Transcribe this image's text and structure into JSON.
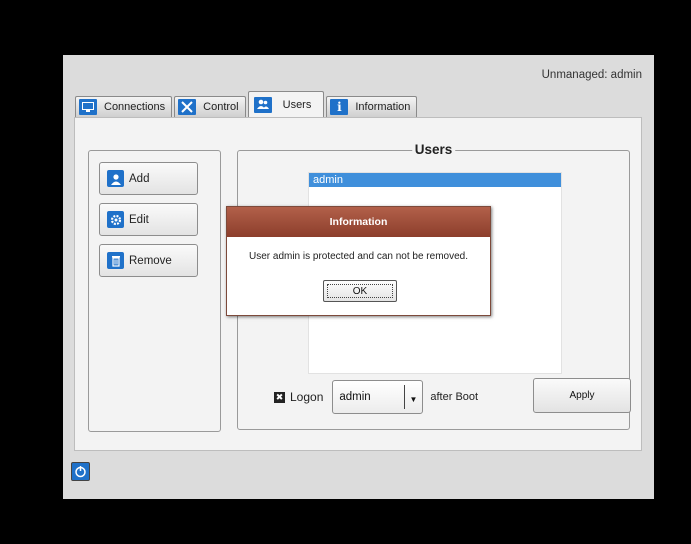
{
  "status": {
    "text": "Unmanaged: admin"
  },
  "tabs": [
    {
      "label": "Connections",
      "icon": "monitor-icon"
    },
    {
      "label": "Control",
      "icon": "tools-icon"
    },
    {
      "label": "Users",
      "icon": "users-icon",
      "active": true
    },
    {
      "label": "Information",
      "icon": "info-icon"
    }
  ],
  "actions": {
    "add_label": "Add",
    "edit_label": "Edit",
    "remove_label": "Remove"
  },
  "users_group": {
    "title": "Users",
    "list": [
      "admin"
    ],
    "selected": "admin",
    "logon_label": "Logon",
    "logon_checked": true,
    "logon_user": "admin",
    "after_boot_label": "after Boot",
    "apply_label": "Apply"
  },
  "dialog": {
    "title": "Information",
    "message": "User admin is protected and can not be removed.",
    "ok_label": "OK"
  },
  "colors": {
    "accent": "#1f71c9",
    "selection": "#3f8fdb",
    "dialog_title": "#9c4a35"
  },
  "power_icon": "power-icon"
}
